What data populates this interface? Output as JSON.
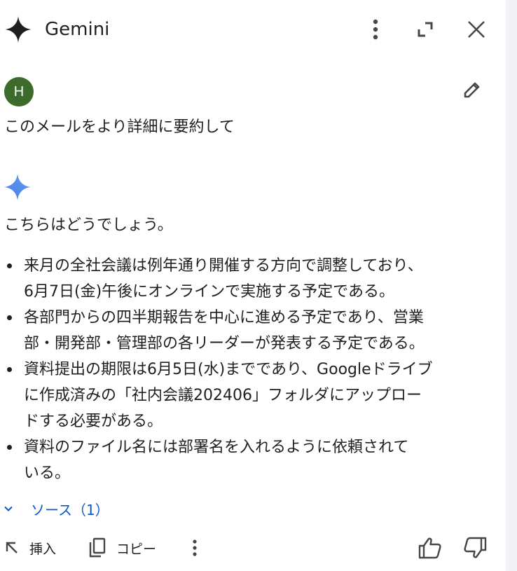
{
  "header": {
    "title": "Gemini",
    "icons": [
      "gemini-spark-icon",
      "more-vert-icon",
      "expand-icon",
      "close-icon"
    ]
  },
  "user": {
    "avatar_initial": "H",
    "avatar_color": "#3d6b2c",
    "prompt": "このメールをより詳細に要約して"
  },
  "response": {
    "intro": "こちらはどうでしょう。",
    "bullets": [
      {
        "lines": [
          "来月の全社会議は例年通り開催する方向で調整しており、",
          "6月7日(金)午後にオンラインで実施する予定である。"
        ]
      },
      {
        "lines": [
          "各部門からの四半期報告を中心に進める予定であり、営業",
          "部・開発部・管理部の各リーダーが発表する予定である。"
        ]
      },
      {
        "lines": [
          "資料提出の期限は6月5日(水)までであり、Googleドライブ",
          "に作成済みの「社内会議202406」フォルダにアップロー",
          "ドする必要がある。"
        ]
      },
      {
        "lines": [
          "資料のファイル名には部署名を入れるように依頼されて",
          "いる。"
        ]
      }
    ]
  },
  "sources": {
    "label": "ソース（1）",
    "accent_color": "#0b57d0"
  },
  "actions": {
    "insert_label": "挿入",
    "copy_label": "コピー"
  }
}
